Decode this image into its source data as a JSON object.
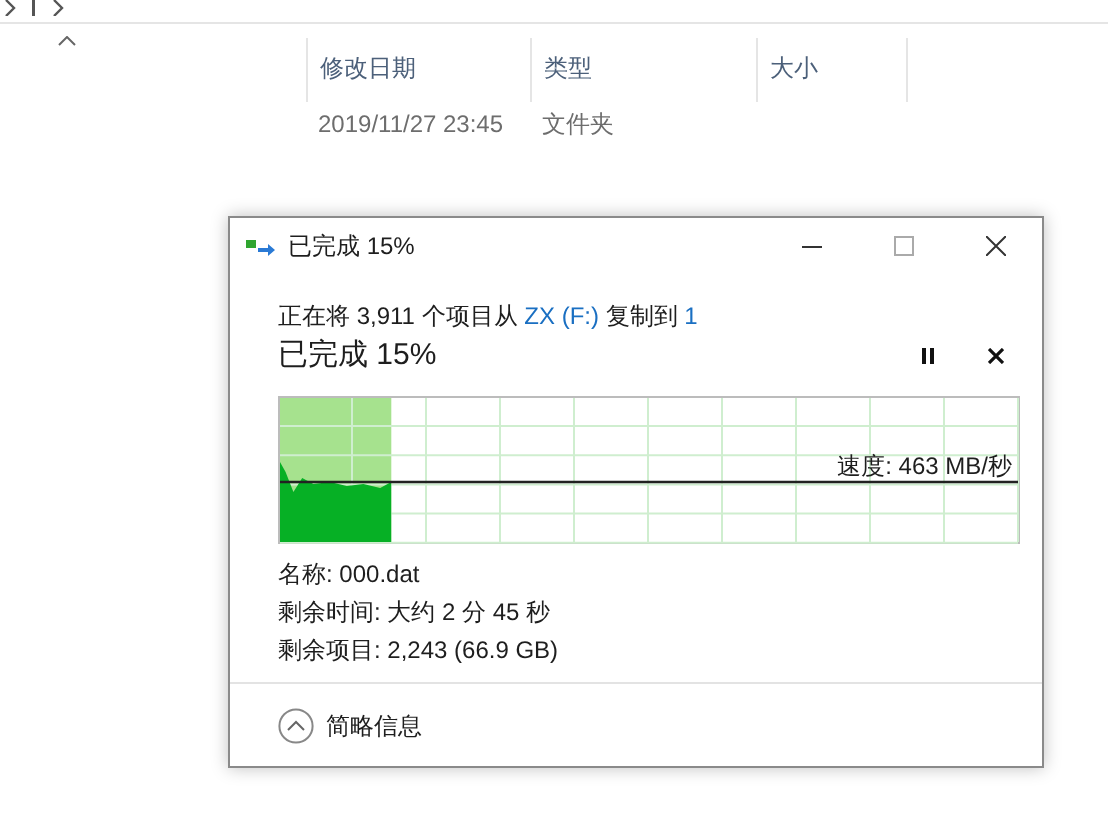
{
  "explorer": {
    "columns": [
      "修改日期",
      "类型",
      "大小"
    ],
    "rows": [
      {
        "date": "2019/11/27 23:45",
        "type": "文件夹"
      }
    ]
  },
  "dialog": {
    "title": "已完成 15%",
    "summary": [
      {
        "kind": "text",
        "text": "正在将 3,911 个项目从"
      },
      {
        "kind": "link",
        "text": "ZX"
      },
      {
        "kind": "link",
        "text": "(F:)"
      },
      {
        "kind": "text",
        "text": "复制到"
      },
      {
        "kind": "link",
        "text": "1"
      }
    ],
    "heading": "已完成 15%",
    "progress": {
      "level": 0.15,
      "speed": "速度: 463 MB/秒"
    },
    "details": [
      "名称: 000.dat",
      "剩余时间: 大约 2 分 45 秒",
      "剩余项目: 2,243 (66.9 GB)"
    ],
    "footer": "简略信息"
  }
}
